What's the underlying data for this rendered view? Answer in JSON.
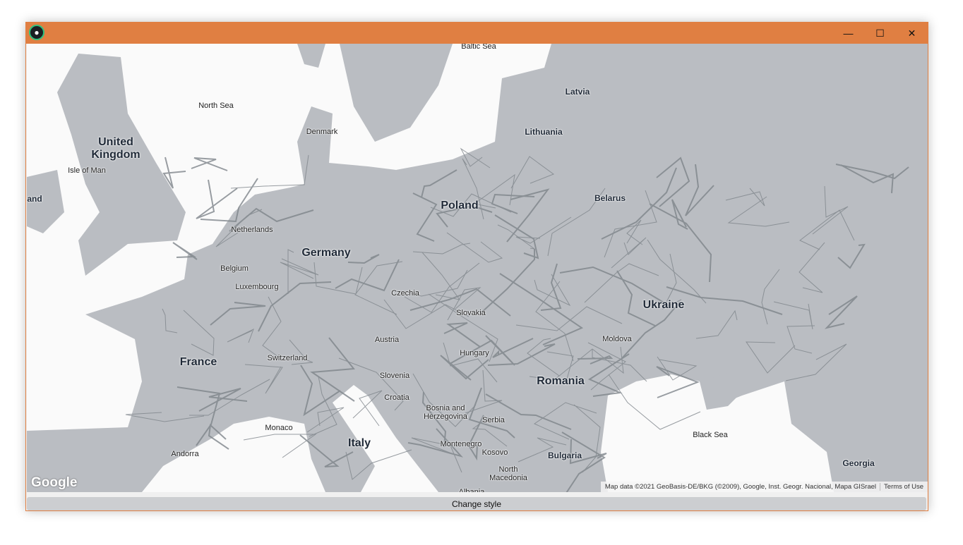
{
  "window": {
    "title_bar_color": "#e07f42",
    "app_icon": "github-icon",
    "controls": {
      "minimize": "—",
      "maximize": "☐",
      "close": "✕"
    }
  },
  "map": {
    "land_color": "#babdc2",
    "water_color": "#fafafa",
    "road_color": "#7f858b",
    "labels": {
      "baltic_sea": "Baltic Sea",
      "north_sea": "North Sea",
      "black_sea": "Black Sea",
      "united_kingdom": "United\nKingdom",
      "isle_of_man": "Isle of Man",
      "ireland": "and",
      "denmark": "Denmark",
      "latvia": "Latvia",
      "lithuania": "Lithuania",
      "poland": "Poland",
      "belarus": "Belarus",
      "netherlands": "Netherlands",
      "germany": "Germany",
      "belgium": "Belgium",
      "luxembourg": "Luxembourg",
      "czechia": "Czechia",
      "slovakia": "Slovakia",
      "ukraine": "Ukraine",
      "austria": "Austria",
      "moldova": "Moldova",
      "hungary": "Hungary",
      "france": "France",
      "switzerland": "Switzerland",
      "slovenia": "Slovenia",
      "romania": "Romania",
      "croatia": "Croatia",
      "bosnia": "Bosnia and\nHerzegovina",
      "serbia": "Serbia",
      "monaco": "Monaco",
      "italy": "Italy",
      "montenegro": "Montenegro",
      "kosovo": "Kosovo",
      "bulgaria": "Bulgaria",
      "andorra": "Andorra",
      "north_macedonia": "North\nMacedonia",
      "albania": "Albania",
      "georgia": "Georgia"
    },
    "logo": "Google",
    "attribution": "Map data ©2021 GeoBasis-DE/BKG (©2009), Google, Inst. Geogr. Nacional, Mapa GISrael",
    "terms": "Terms of Use"
  },
  "change_style_button": "Change style"
}
